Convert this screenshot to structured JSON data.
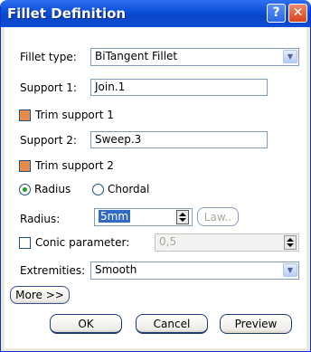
{
  "window": {
    "title": "Fillet Definition",
    "help_label": "?",
    "close_label": "✕"
  },
  "fillet_type": {
    "label": "Fillet type:",
    "value": "BiTangent Fillet"
  },
  "support1": {
    "label": "Support 1:",
    "value": "Join.1"
  },
  "trim1": {
    "label": "Trim support 1",
    "checked": true
  },
  "support2": {
    "label": "Support 2:",
    "value": "Sweep.3"
  },
  "trim2": {
    "label": "Trim support 2",
    "checked": true
  },
  "mode": {
    "radius_label": "Radius",
    "chordal_label": "Chordal",
    "selected": "Radius"
  },
  "radius": {
    "label": "Radius:",
    "value": "5mm",
    "law_label": "Law.."
  },
  "conic": {
    "label": "Conic parameter:",
    "value": "0,5",
    "checked": false
  },
  "extremities": {
    "label": "Extremities:",
    "value": "Smooth"
  },
  "more_label": "More >>",
  "footer": {
    "ok": "OK",
    "cancel": "Cancel",
    "preview": "Preview"
  },
  "colors": {
    "title_blue": "#0a4ed8",
    "check_orange": "#e88a4a",
    "ok_green": "#21a121",
    "cancel_red": "#d9431e"
  }
}
